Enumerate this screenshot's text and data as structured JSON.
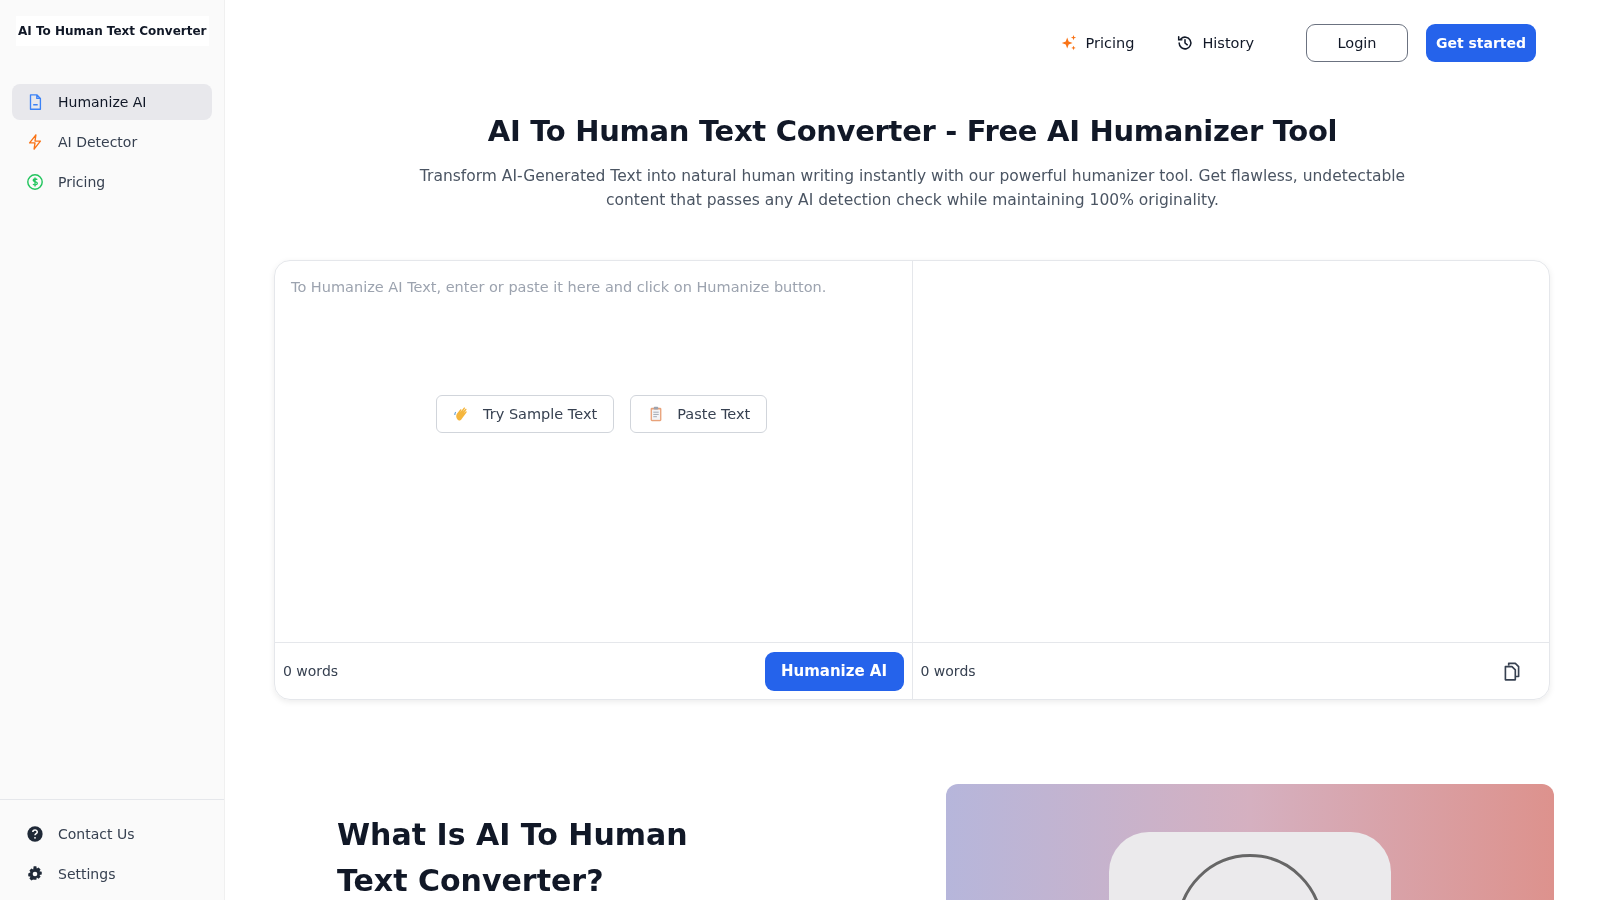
{
  "sidebar": {
    "logo": "AI To Human Text Converter",
    "items": [
      {
        "label": "Humanize AI",
        "kind": "document",
        "selected": true
      },
      {
        "label": "AI Detector",
        "kind": "bolt",
        "selected": false
      },
      {
        "label": "Pricing",
        "kind": "dollar",
        "selected": false
      }
    ],
    "footer_items": [
      {
        "label": "Contact Us",
        "kind": "help"
      },
      {
        "label": "Settings",
        "kind": "gear"
      }
    ]
  },
  "header": {
    "links": [
      {
        "label": "Pricing",
        "kind": "sparkle"
      },
      {
        "label": "History",
        "kind": "history"
      }
    ],
    "login": "Login",
    "cta": "Get started"
  },
  "hero": {
    "title": "AI To Human Text Converter - Free AI Humanizer Tool",
    "subtitle": "Transform AI-Generated Text into natural human writing instantly with our powerful humanizer tool. Get flawless, undetectable content that passes any AI detection check while maintaining 100% originality."
  },
  "editor": {
    "placeholder": "To Humanize AI Text, enter or paste it here and click on Humanize button.",
    "actions": [
      {
        "label": "Try Sample Text",
        "kind": "hand"
      },
      {
        "label": "Paste Text",
        "kind": "clipboard"
      }
    ],
    "input_count": "0 words",
    "submit": "Humanize AI",
    "output_count": "0 words"
  },
  "section": {
    "title": "What Is AI To Human Text Converter?"
  }
}
